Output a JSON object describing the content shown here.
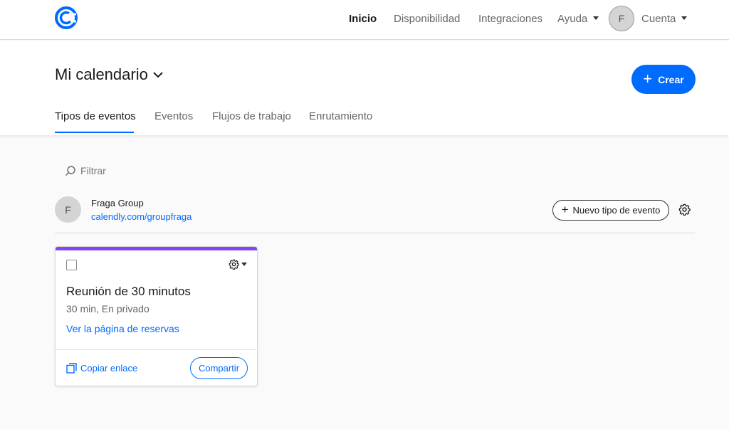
{
  "nav": {
    "items": [
      {
        "label": "Inicio",
        "active": true
      },
      {
        "label": "Disponibilidad",
        "active": false
      },
      {
        "label": "Integraciones",
        "active": false
      },
      {
        "label": "Ayuda",
        "active": false
      }
    ],
    "avatar_initial": "F",
    "account_label": "Cuenta"
  },
  "header": {
    "title": "Mi calendario",
    "create_label": "Crear",
    "tabs": [
      {
        "label": "Tipos de eventos",
        "active": true
      },
      {
        "label": "Eventos",
        "active": false
      },
      {
        "label": "Flujos de trabajo",
        "active": false
      },
      {
        "label": "Enrutamiento",
        "active": false
      }
    ]
  },
  "filter": {
    "placeholder": "Filtrar"
  },
  "group": {
    "avatar_initial": "F",
    "name": "Fraga Group",
    "link": "calendly.com/groupfraga",
    "new_event_label": "Nuevo tipo de evento"
  },
  "event_card": {
    "accent_color": "#8247f5",
    "title": "Reunión de 30 minutos",
    "meta": "30 min, En privado",
    "booking_link": "Ver la página de reservas",
    "copy_label": "Copiar enlace",
    "share_label": "Compartir"
  },
  "colors": {
    "brand": "#006bff",
    "card_accent": "#8247f5"
  }
}
